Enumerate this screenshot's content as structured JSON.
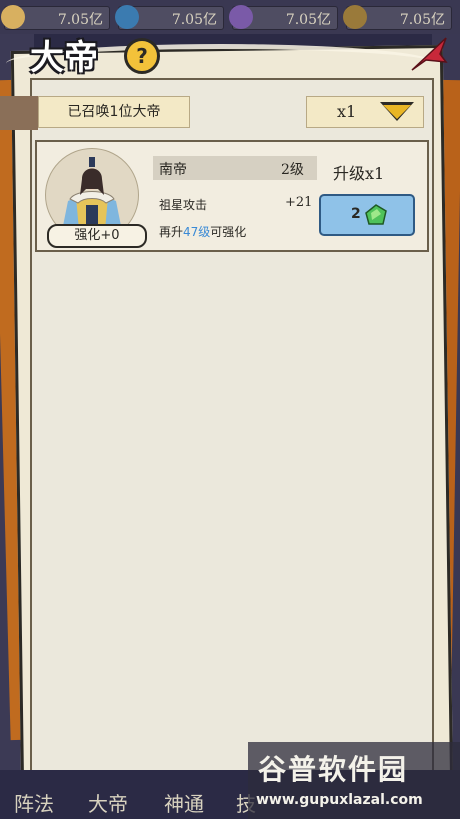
{
  "resources": [
    {
      "icon": "coin-icon",
      "value": "7.05亿",
      "color": "#d8b060"
    },
    {
      "icon": "orb-icon",
      "value": "7.05亿",
      "color": "#3b7bb0"
    },
    {
      "icon": "spirit-icon",
      "value": "7.05亿",
      "color": "#7a5aa8"
    },
    {
      "icon": "crystal-icon",
      "value": "7.05亿",
      "color": "#9a7a3a"
    }
  ],
  "header": {
    "title": "大帝",
    "help": "?"
  },
  "summon": {
    "label": "已召唤1位大帝"
  },
  "multiplier": {
    "selected": "x1"
  },
  "emperor": {
    "name": "南帝",
    "level": "2级",
    "enhance": "强化+0",
    "stat_name": "祖星攻击",
    "stat_value": "+21",
    "hint_prefix": "再升",
    "hint_level": "47级",
    "hint_suffix": "可强化",
    "upgrade_label": "升级x1",
    "upgrade_cost": "2"
  },
  "tabs": [
    "阵法",
    "大帝",
    "神通",
    "技"
  ],
  "watermark": {
    "title": "谷普软件园",
    "url": "www.gupuxlazal.com"
  }
}
